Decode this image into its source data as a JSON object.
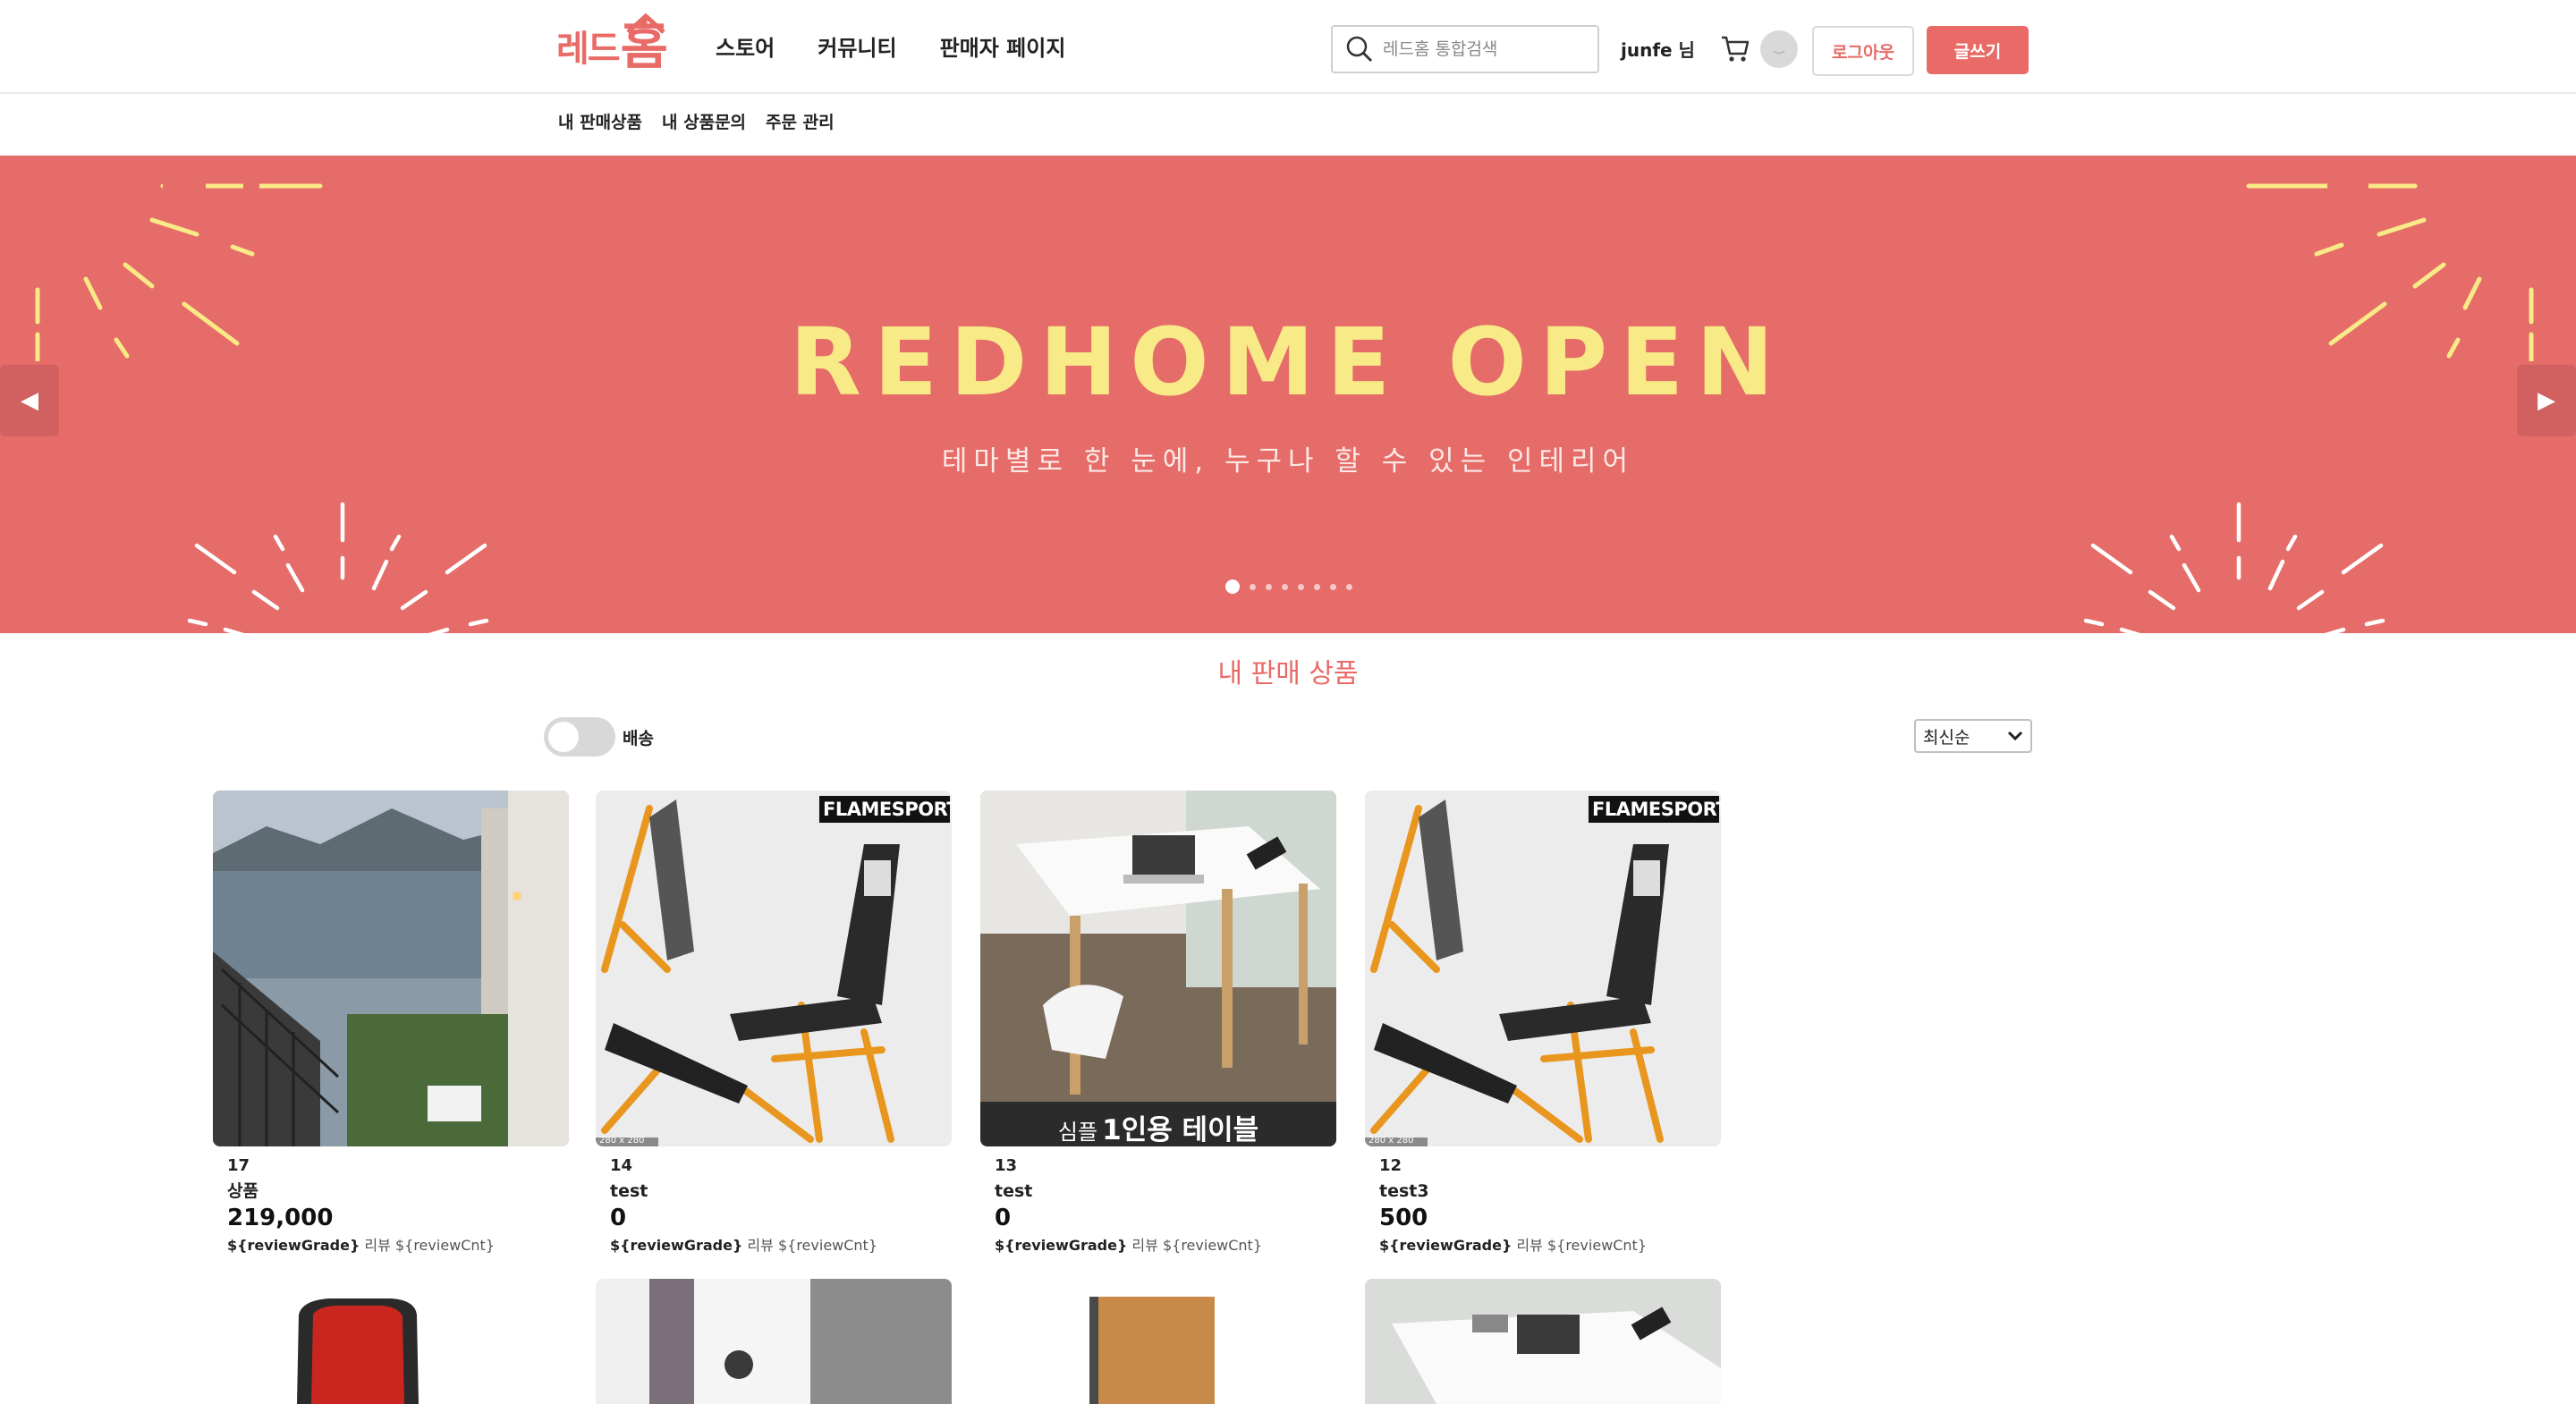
{
  "header": {
    "logo_part1": "레드",
    "logo_part2": "홈",
    "nav": [
      "스토어",
      "커뮤니티",
      "판매자 페이지"
    ],
    "search_placeholder": "레드홈 통합검색",
    "username": "junfe 님",
    "logout_label": "로그아웃",
    "write_label": "글쓰기"
  },
  "subnav": [
    "내 판매상품",
    "내 상품문의",
    "주문 관리"
  ],
  "banner": {
    "title": "REDHOME OPEN",
    "subtitle": "테마별로 한 눈에, 누구나 할 수 있는 인테리어",
    "slide_count": 8,
    "active_slide": 1,
    "colors": {
      "background": "#e66c69",
      "title": "#f8ea86"
    }
  },
  "section": {
    "title": "내 판매 상품",
    "toggle_label": "배송",
    "sort_selected": "최신순"
  },
  "products": [
    {
      "id": "17",
      "name": "상품",
      "price": "219,000",
      "review_grade": "${reviewGrade}",
      "review_label": "리뷰",
      "review_cnt": "${reviewCnt}",
      "image": "seaside-stairs"
    },
    {
      "id": "14",
      "name": "test",
      "price": "0",
      "review_grade": "${reviewGrade}",
      "review_label": "리뷰",
      "review_cnt": "${reviewCnt}",
      "image": "weight-bench",
      "brand": "FLAMESPORT",
      "size_tag": "280 x 280"
    },
    {
      "id": "13",
      "name": "test",
      "price": "0",
      "review_grade": "${reviewGrade}",
      "review_label": "리뷰",
      "review_cnt": "${reviewCnt}",
      "image": "desk",
      "caption_small": "심플",
      "caption_big": "1인용 테이블"
    },
    {
      "id": "12",
      "name": "test3",
      "price": "500",
      "review_grade": "${reviewGrade}",
      "review_label": "리뷰",
      "review_cnt": "${reviewCnt}",
      "image": "weight-bench",
      "brand": "FLAMESPORT",
      "size_tag": "280 x 280"
    }
  ],
  "products_row2_images": [
    "red-chair",
    "room-interior",
    "wood-cabinet",
    "desk"
  ],
  "colors": {
    "accent": "#e86b67"
  }
}
